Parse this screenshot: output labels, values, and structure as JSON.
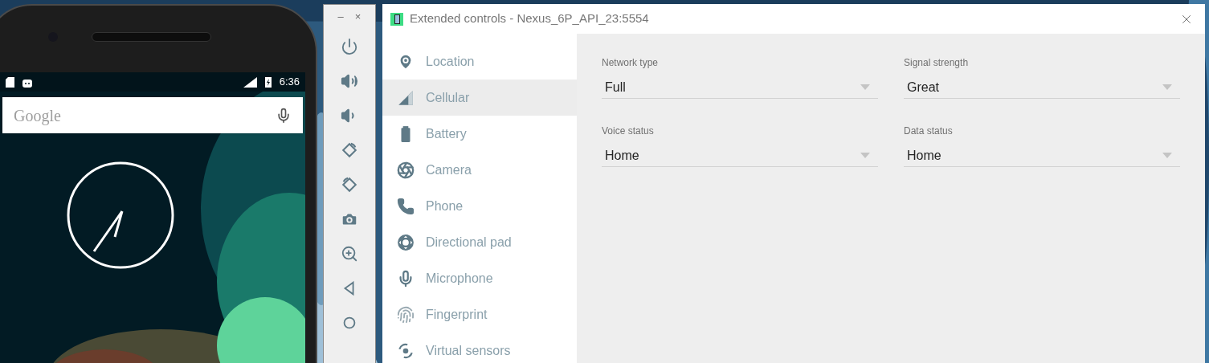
{
  "phone": {
    "status_bar": {
      "time": "6:36"
    },
    "search": {
      "placeholder": "Google"
    }
  },
  "side_toolbar": {
    "window_buttons": [
      "–",
      "×"
    ]
  },
  "window": {
    "title": "Extended controls - Nexus_6P_API_23:5554"
  },
  "sidebar": {
    "items": [
      {
        "label": "Location",
        "selected": false
      },
      {
        "label": "Cellular",
        "selected": true
      },
      {
        "label": "Battery",
        "selected": false
      },
      {
        "label": "Camera",
        "selected": false
      },
      {
        "label": "Phone",
        "selected": false
      },
      {
        "label": "Directional pad",
        "selected": false
      },
      {
        "label": "Microphone",
        "selected": false
      },
      {
        "label": "Fingerprint",
        "selected": false
      },
      {
        "label": "Virtual sensors",
        "selected": false
      }
    ]
  },
  "fields": [
    {
      "label": "Network type",
      "value": "Full"
    },
    {
      "label": "Signal strength",
      "value": "Great"
    },
    {
      "label": "Voice status",
      "value": "Home"
    },
    {
      "label": "Data status",
      "value": "Home"
    }
  ]
}
